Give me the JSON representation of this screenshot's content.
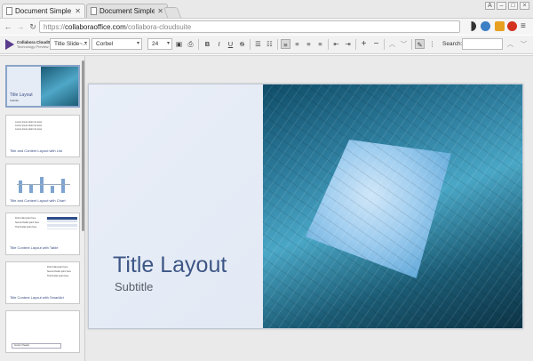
{
  "browser": {
    "tabs": [
      {
        "title": "Document Simple Ex",
        "active": true
      },
      {
        "title": "Document Simple Ex",
        "active": false
      }
    ],
    "url": {
      "scheme": "https://",
      "host": "collaboraoffice.com",
      "path": "/collabora-cloudsuite"
    }
  },
  "toolbar": {
    "logo": {
      "name": "Collabora CloudSuite",
      "sub": "Technology Preview"
    },
    "style_combo": "Title Slide~...",
    "font_combo": "Corbel",
    "size_combo": "24",
    "search_label": "Search:",
    "search_value": ""
  },
  "slides": [
    {
      "title": "Title Layout",
      "subtitle": "Subtitle"
    },
    {
      "title": "Title and Content Layout with List",
      "lines": [
        "Lorem ipsum dolor sit amet",
        "Lorem ipsum dolor sit amet",
        "Lorem ipsum dolor sit amet"
      ]
    },
    {
      "title": "Title and Content Layout with Chart"
    },
    {
      "title": "Title Content Layout with Table",
      "lines": [
        "First bullet point here",
        "Second bullet point here",
        "Third bullet point here"
      ]
    },
    {
      "title": "Title Content Layout with SmartArt",
      "lines": [
        "First bullet point here",
        "Second bullet point here",
        "Third bullet point here"
      ]
    },
    {
      "title": "",
      "lines": [
        "Section Header"
      ]
    }
  ],
  "main_slide": {
    "title": "Title Layout",
    "subtitle": "Subtitle"
  },
  "colors": {
    "accent": "#3d5685",
    "logo": "#5a3b8c"
  }
}
